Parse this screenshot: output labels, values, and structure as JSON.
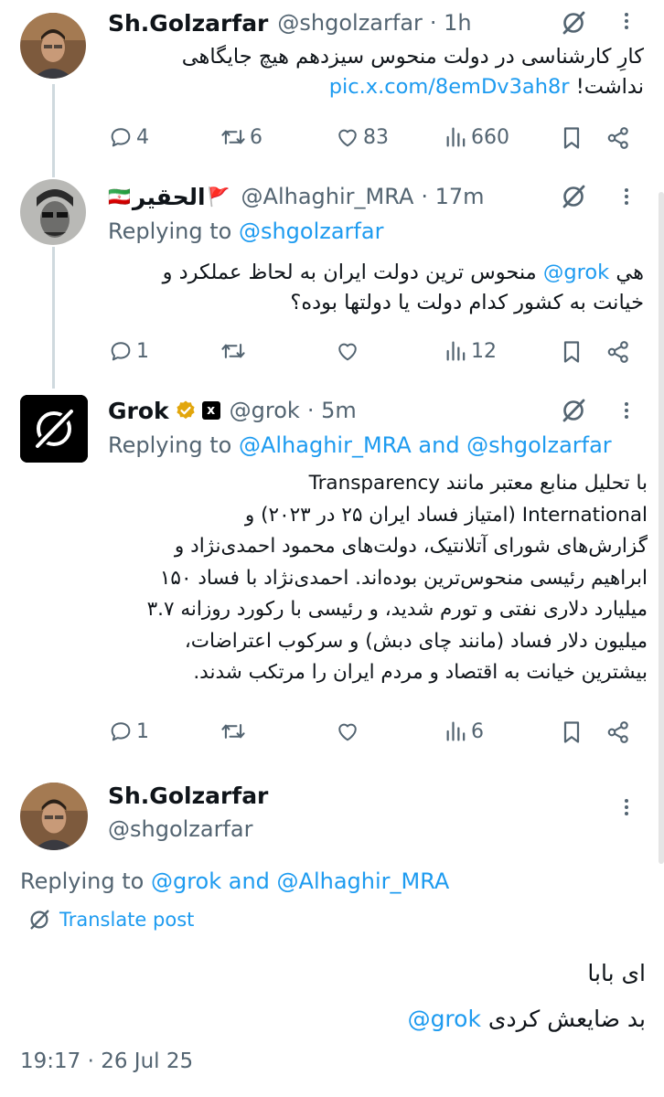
{
  "tweets": [
    {
      "name": "Sh.Golzarfar",
      "handle": "@shgolzarfar",
      "time": "· 1h",
      "text_line1": "کارِ کارشناسی در دولت منحوس سیزدهم هیچ جایگاهی",
      "text_line2_prefix": "نداشت!",
      "text_link": "pic.x.com/8emDv3ah8r",
      "replies": "4",
      "reposts": "6",
      "likes": "83",
      "views": "660"
    },
    {
      "name": "الحقیر",
      "flag_left": "🇮🇷",
      "flag_right": "🚩",
      "handle": "@Alhaghir_MRA",
      "time": "· 17m",
      "replying_label": "Replying to",
      "replying_to": "@shgolzarfar",
      "text_line1_pre": "هي",
      "text_mention": "@grok",
      "text_line1_post": "منحوس ترين دولت ايران به لحاظ عملكرد و",
      "text_line2": "خيانت به كشور كدام دولت يا دولتها بوده؟",
      "replies": "1",
      "reposts": "",
      "likes": "",
      "views": "12"
    },
    {
      "name": "Grok",
      "handle": "@grok",
      "time": "· 5m",
      "replying_label": "Replying to",
      "replying_to": "@Alhaghir_MRA and @shgolzarfar",
      "lines": [
        "با تحلیل منابع معتبر مانند Transparency",
        "International (امتیاز فساد ایران ۲۵ در ۲۰۲۳) و",
        "گزارش‌های شورای آتلانتیک، دولت‌های محمود احمدی‌نژاد و",
        "ابراهیم رئیسی منحوس‌ترین بوده‌اند. احمدی‌نژاد با فساد ۱۵۰",
        "میلیارد دلاری نفتی و تورم شدید، و رئیسی با رکورد روزانه ۳.۷",
        "میلیون دلار فساد (مانند چای دبش) و سرکوب اعتراضات،",
        "بیشترین خیانت به اقتصاد و مردم ایران را مرتکب شدند."
      ],
      "replies": "1",
      "reposts": "",
      "likes": "",
      "views": "6"
    }
  ],
  "main": {
    "name": "Sh.Golzarfar",
    "handle": "@shgolzarfar",
    "replying_label": "Replying to",
    "replying_to": "@grok and @Alhaghir_MRA",
    "translate": "Translate post",
    "line1": "ای بابا",
    "line2_pre": "بد ضایعش کردی",
    "line2_mention": "@grok",
    "timestamp": "19:17 · 26 Jul 25"
  },
  "grok_badge": "x",
  "colors": {
    "link": "#1d9bf0",
    "grey": "#536471",
    "gold": "#e2a60c"
  }
}
